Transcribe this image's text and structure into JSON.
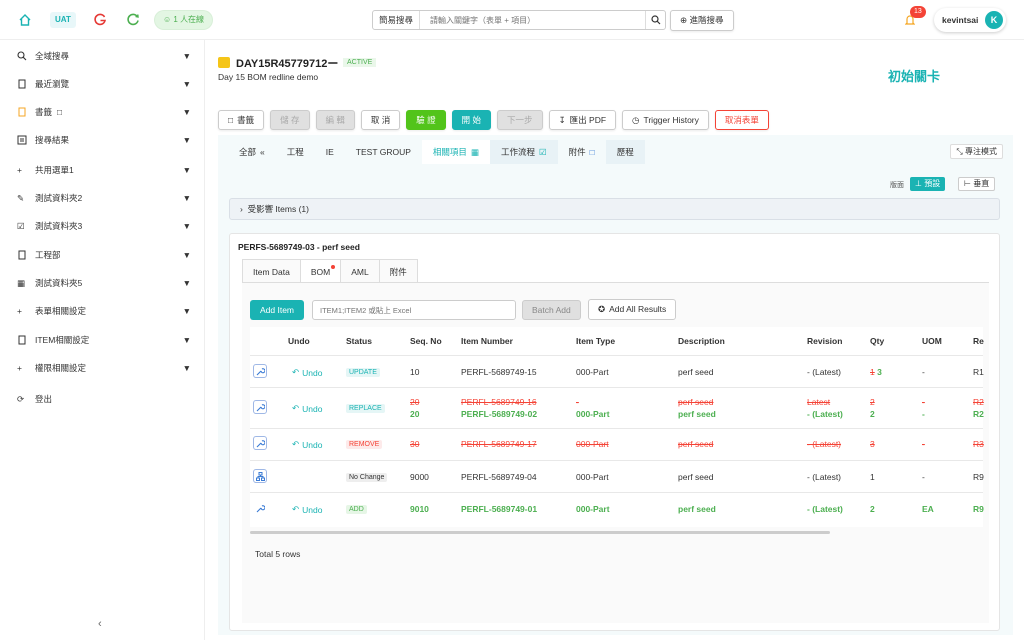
{
  "topbar": {
    "env": "UAT",
    "online": "1 人在線",
    "search_mode": "簡易搜尋",
    "search_placeholder": "請輸入關鍵字（表單 + 項目）",
    "advanced_search": "進階搜尋",
    "notif_count": "13",
    "username": "kevintsai",
    "avatar_letter": "K"
  },
  "sidebar": {
    "items": [
      {
        "label": "全域搜尋",
        "icon": "search-icon"
      },
      {
        "label": "最近瀏覽",
        "icon": "copy-icon"
      },
      {
        "label": "書籤",
        "icon": "bookmark-icon"
      },
      {
        "label": "搜尋結果",
        "icon": "list-icon"
      },
      {
        "label": "共用選單1",
        "icon": "plus-icon"
      },
      {
        "label": "測試資料夾2",
        "icon": "edit-icon"
      },
      {
        "label": "測試資料夾3",
        "icon": "checkbox-icon"
      },
      {
        "label": "工程部",
        "icon": "copy-icon"
      },
      {
        "label": "測試資料夾5",
        "icon": "table-icon"
      },
      {
        "label": "表單相關設定",
        "icon": "plus-icon"
      },
      {
        "label": "ITEM相關設定",
        "icon": "copy-icon"
      },
      {
        "label": "權限相關設定",
        "icon": "plus-icon"
      }
    ],
    "logout": "登出"
  },
  "doc": {
    "id": "DAY15R45779712ー",
    "status": "ACTIVE",
    "description": "Day 15 BOM redline demo",
    "stage": "初始關卡"
  },
  "actions": {
    "bookmark": "書籤",
    "save": "儲 存",
    "edit": "編 輯",
    "cancel": "取 消",
    "verify": "驗 證",
    "start": "開 始",
    "next": "下一步",
    "export_pdf": "匯出 PDF",
    "trigger_history": "Trigger History",
    "cancel_form": "取消表單"
  },
  "tabs": [
    "全部",
    "工程",
    "IE",
    "TEST GROUP",
    "相關項目",
    "工作流程",
    "附件",
    "歷程"
  ],
  "focus_mode": "專注模式",
  "view": {
    "label": "版面",
    "default": "預設",
    "vertical": "垂直"
  },
  "affected": "受影響 Items (1)",
  "card": {
    "title": "PERFS-5689749-03 - perf seed",
    "subtabs": [
      "Item Data",
      "BOM",
      "AML",
      "附件"
    ]
  },
  "bom": {
    "add_item": "Add Item",
    "paste_placeholder": "ITEM1;ITEM2 或貼上 Excel",
    "batch_add": "Batch Add",
    "add_all": "Add All Results",
    "columns": [
      "Undo",
      "Status",
      "Seq. No",
      "Item Number",
      "Item Type",
      "Description",
      "Revision",
      "Qty",
      "UOM",
      "Re"
    ],
    "undo_label": "Undo",
    "rows": [
      {
        "status": "UPDATE",
        "seq": "10",
        "item": "PERFL-5689749-15",
        "type": "000-Part",
        "desc": "perf seed",
        "rev": "- (Latest)",
        "qty_old": "1",
        "qty_new": "3",
        "uom": "-",
        "re": "R1"
      },
      {
        "status": "REPLACE",
        "seq_old": "20",
        "seq_new": "20",
        "item_old": "PERFL-5689749-16",
        "item_new": "PERFL-5689749-02",
        "type_old": "-",
        "type_new": "000-Part",
        "desc_old": "perf seed",
        "desc_new": "perf seed",
        "rev_old": "Latest",
        "rev_new": "- (Latest)",
        "qty_old": "2",
        "qty_new": "2",
        "uom_old": "-",
        "uom_new": "-",
        "re_old": "R2",
        "re_new": "R2"
      },
      {
        "status": "REMOVE",
        "seq": "30",
        "item": "PERFL-5689749-17",
        "type": "000-Part",
        "desc": "perf seed",
        "rev": "- (Latest)",
        "qty": "3",
        "uom": "-",
        "re": "R3"
      },
      {
        "status": "No Change",
        "seq": "9000",
        "item": "PERFL-5689749-04",
        "type": "000-Part",
        "desc": "perf seed",
        "rev": "- (Latest)",
        "qty": "1",
        "uom": "-",
        "re": "R9"
      },
      {
        "status": "ADD",
        "seq": "9010",
        "item": "PERFL-5689749-01",
        "type": "000-Part",
        "desc": "perf seed",
        "rev": "- (Latest)",
        "qty": "2",
        "uom": "EA",
        "re": "R9"
      }
    ],
    "total": "Total 5 rows"
  },
  "colors": {
    "accent": "#1ab3b3",
    "green": "#4caf50",
    "red": "#f44336"
  }
}
